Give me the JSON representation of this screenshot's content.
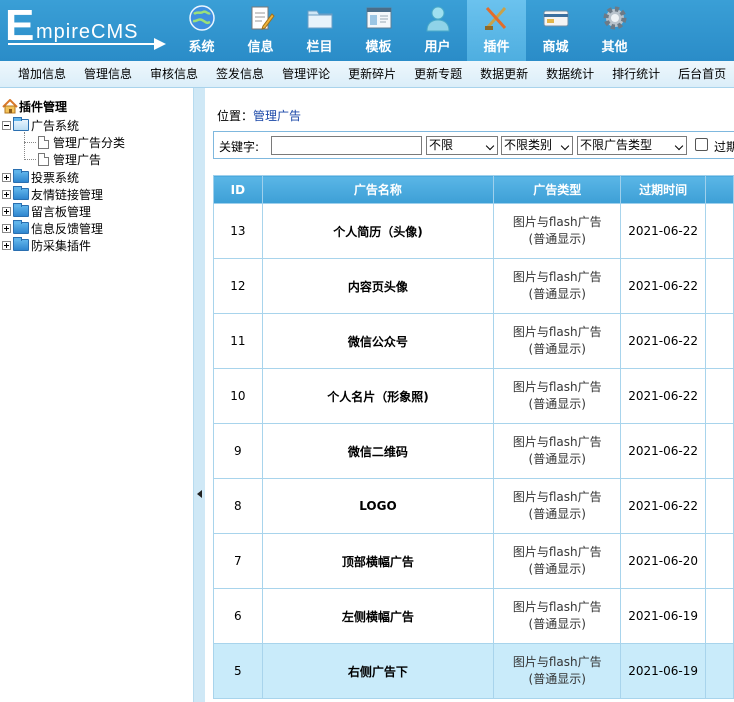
{
  "logo": {
    "first": "E",
    "rest": "mpireCMS"
  },
  "topnav": [
    {
      "label": "系统",
      "icon": "globe-icon",
      "active": false
    },
    {
      "label": "信息",
      "icon": "document-pencil-icon",
      "active": false
    },
    {
      "label": "栏目",
      "icon": "folder-icon",
      "active": false
    },
    {
      "label": "模板",
      "icon": "window-template-icon",
      "active": false
    },
    {
      "label": "用户",
      "icon": "user-icon",
      "active": false
    },
    {
      "label": "插件",
      "icon": "tools-icon",
      "active": true
    },
    {
      "label": "商城",
      "icon": "card-icon",
      "active": false
    },
    {
      "label": "其他",
      "icon": "gear-icon",
      "active": false
    }
  ],
  "submenu": [
    "增加信息",
    "管理信息",
    "审核信息",
    "签发信息",
    "管理评论",
    "更新碎片",
    "更新专题",
    "数据更新",
    "数据统计",
    "排行统计",
    "后台首页"
  ],
  "tree": {
    "title": "插件管理",
    "nodes": [
      {
        "label": "广告系统",
        "expanded": true,
        "children": [
          "管理广告分类",
          "管理广告"
        ]
      },
      {
        "label": "投票系统",
        "expanded": false
      },
      {
        "label": "友情链接管理",
        "expanded": false
      },
      {
        "label": "留言板管理",
        "expanded": false
      },
      {
        "label": "信息反馈管理",
        "expanded": false
      },
      {
        "label": "防采集插件",
        "expanded": false
      }
    ]
  },
  "breadcrumb": {
    "prefix": "位置：",
    "link": "管理广告"
  },
  "search": {
    "keyword_label": "关键字:",
    "keyword_value": "",
    "select1": "不限",
    "select2": "不限类别",
    "select3": "不限广告类型",
    "checkbox_label": "过期"
  },
  "table": {
    "headers": [
      "ID",
      "广告名称",
      "广告类型",
      "过期时间"
    ],
    "type_line1": "图片与flash广告",
    "type_line2": "(普通显示)",
    "rows": [
      {
        "id": "13",
        "name": "个人简历（头像)",
        "expires": "2021-06-22"
      },
      {
        "id": "12",
        "name": "内容页头像",
        "expires": "2021-06-22"
      },
      {
        "id": "11",
        "name": "微信公众号",
        "expires": "2021-06-22"
      },
      {
        "id": "10",
        "name": "个人名片（形象照)",
        "expires": "2021-06-22"
      },
      {
        "id": "9",
        "name": "微信二维码",
        "expires": "2021-06-22"
      },
      {
        "id": "8",
        "name": "LOGO",
        "expires": "2021-06-22"
      },
      {
        "id": "7",
        "name": "顶部横幅广告",
        "expires": "2021-06-20"
      },
      {
        "id": "6",
        "name": "左侧横幅广告",
        "expires": "2021-06-19"
      },
      {
        "id": "5",
        "name": "右侧广告下",
        "expires": "2021-06-19",
        "highlighted": true
      }
    ]
  },
  "colors": {
    "accent": "#2a8cc8",
    "header_row": "#4aabde",
    "highlight_row": "#c9ebfa"
  }
}
